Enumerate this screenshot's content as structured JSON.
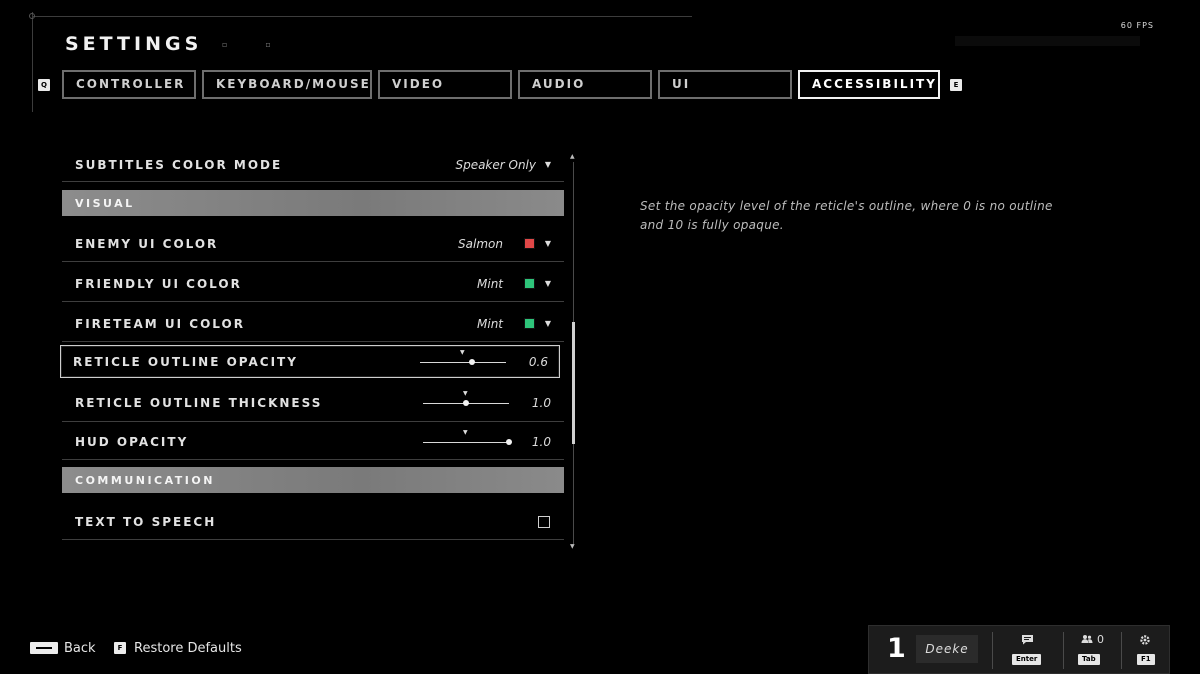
{
  "header": {
    "title": "SETTINGS",
    "fps": "60 FPS"
  },
  "tabs": {
    "prev_key": "Q",
    "next_key": "E",
    "items": [
      {
        "label": "CONTROLLER",
        "active": false
      },
      {
        "label": "KEYBOARD/MOUSE",
        "active": false
      },
      {
        "label": "VIDEO",
        "active": false
      },
      {
        "label": "AUDIO",
        "active": false
      },
      {
        "label": "UI",
        "active": false
      },
      {
        "label": "ACCESSIBILITY",
        "active": true
      }
    ]
  },
  "settings": {
    "subtitles_color_mode": {
      "label": "SUBTITLES COLOR MODE",
      "value": "Speaker Only"
    },
    "section_visual": "VISUAL",
    "enemy_ui_color": {
      "label": "ENEMY UI COLOR",
      "value": "Salmon",
      "color": "#e04848"
    },
    "friendly_ui_color": {
      "label": "FRIENDLY UI COLOR",
      "value": "Mint",
      "color": "#2ec47a"
    },
    "fireteam_ui_color": {
      "label": "FIRETEAM UI COLOR",
      "value": "Mint",
      "color": "#2ec47a"
    },
    "reticle_outline_opacity": {
      "label": "RETICLE OUTLINE OPACITY",
      "value": "0.6",
      "level": 0.6
    },
    "reticle_outline_thickness": {
      "label": "RETICLE OUTLINE THICKNESS",
      "value": "1.0",
      "level": 0.5
    },
    "hud_opacity": {
      "label": "HUD OPACITY",
      "value": "1.0",
      "level": 1.0
    },
    "section_communication": "COMMUNICATION",
    "text_to_speech": {
      "label": "TEXT TO SPEECH",
      "checked": false
    }
  },
  "description": "Set the opacity level of the reticle's outline, where 0 is no outline and 10 is fully opaque.",
  "footer": {
    "back_label": "Back",
    "restore_key": "F",
    "restore_label": "Restore Defaults"
  },
  "player": {
    "rank": "1",
    "name": "Deeke",
    "chat_key": "Enter",
    "party_count": "0",
    "party_key": "Tab",
    "settings_key": "F1"
  },
  "icons": {
    "dropdown": "chevron-down-icon",
    "chat": "chat-icon",
    "party": "party-icon",
    "settings": "gear-icon"
  }
}
